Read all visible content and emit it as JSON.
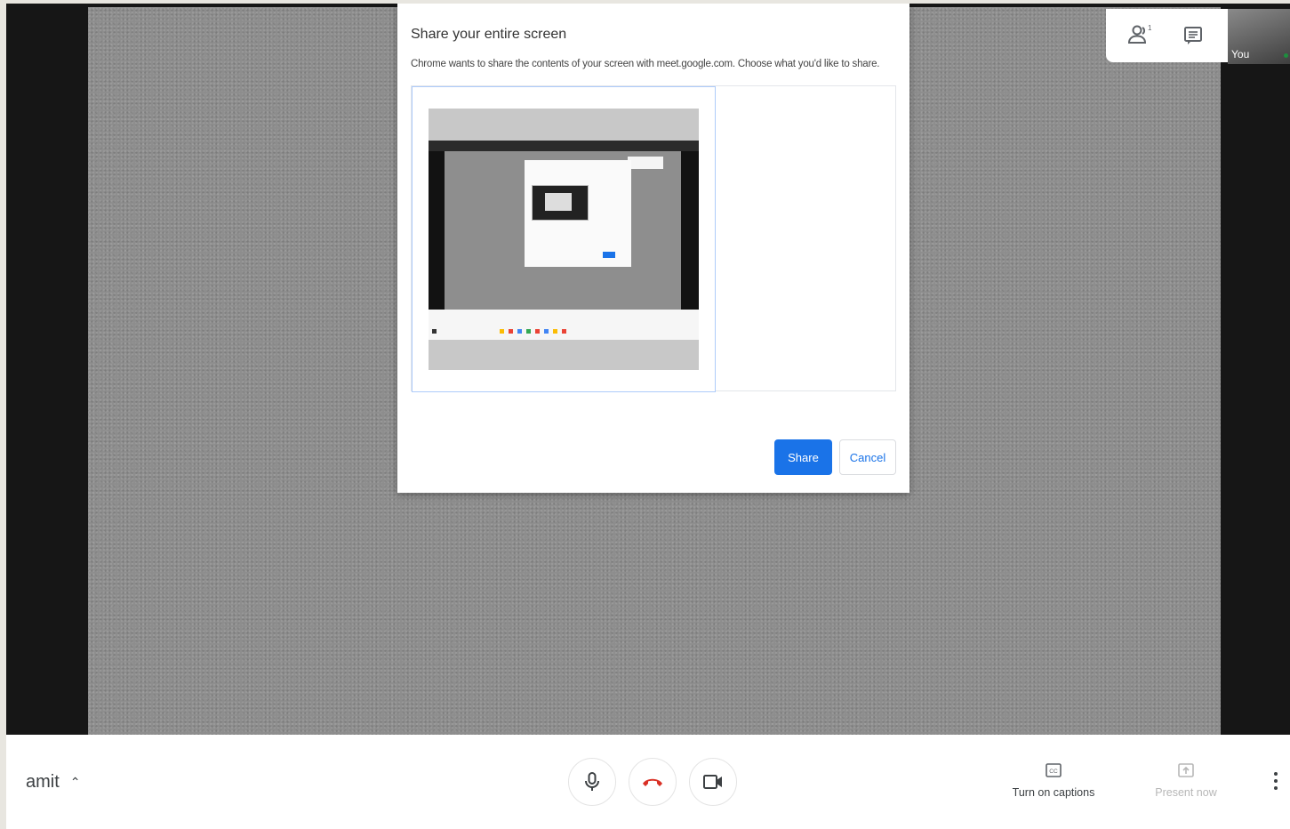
{
  "dialog": {
    "title": "Share your entire screen",
    "description": "Chrome wants to share the contents of your screen with meet.google.com. Choose what you'd like to share.",
    "share_label": "Share",
    "cancel_label": "Cancel"
  },
  "top_panel": {
    "people_icon": "people-icon",
    "people_count": "1",
    "chat_icon": "chat-icon"
  },
  "self_view": {
    "label": "You"
  },
  "bottom_bar": {
    "meeting_name": "amit",
    "controls": {
      "mic_icon": "microphone-icon",
      "hangup_icon": "phone-hangup-icon",
      "camera_icon": "camera-icon",
      "hangup_color": "#d93025"
    },
    "captions_label": "Turn on captions",
    "present_label": "Present now"
  },
  "colors": {
    "accent": "#1a73e8"
  }
}
